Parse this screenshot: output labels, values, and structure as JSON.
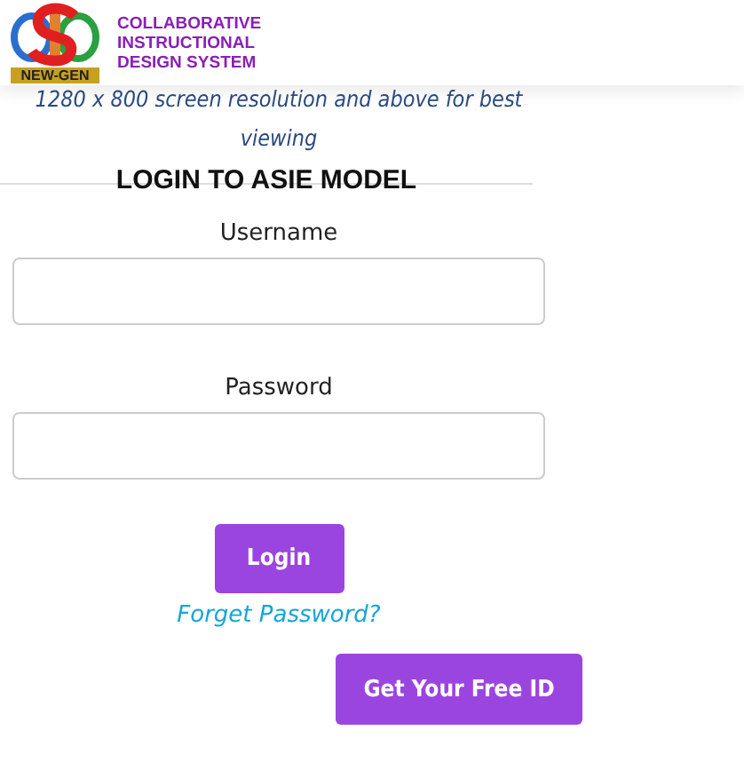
{
  "header": {
    "logo_text": "NEW-GEN",
    "title_lines": [
      "COLLABORATIVE",
      "INSTRUCTIONAL",
      "DESIGN SYSTEM"
    ]
  },
  "notice": "1280 x 800 screen resolution and above for best viewing",
  "login": {
    "heading": "LOGIN TO ASIE MODEL",
    "fields": [
      {
        "label": "Username"
      },
      {
        "label": "Password"
      }
    ],
    "submit": "Login",
    "forgot_link": "Forget Password?"
  },
  "free_id_button": "Get Your Free ID"
}
